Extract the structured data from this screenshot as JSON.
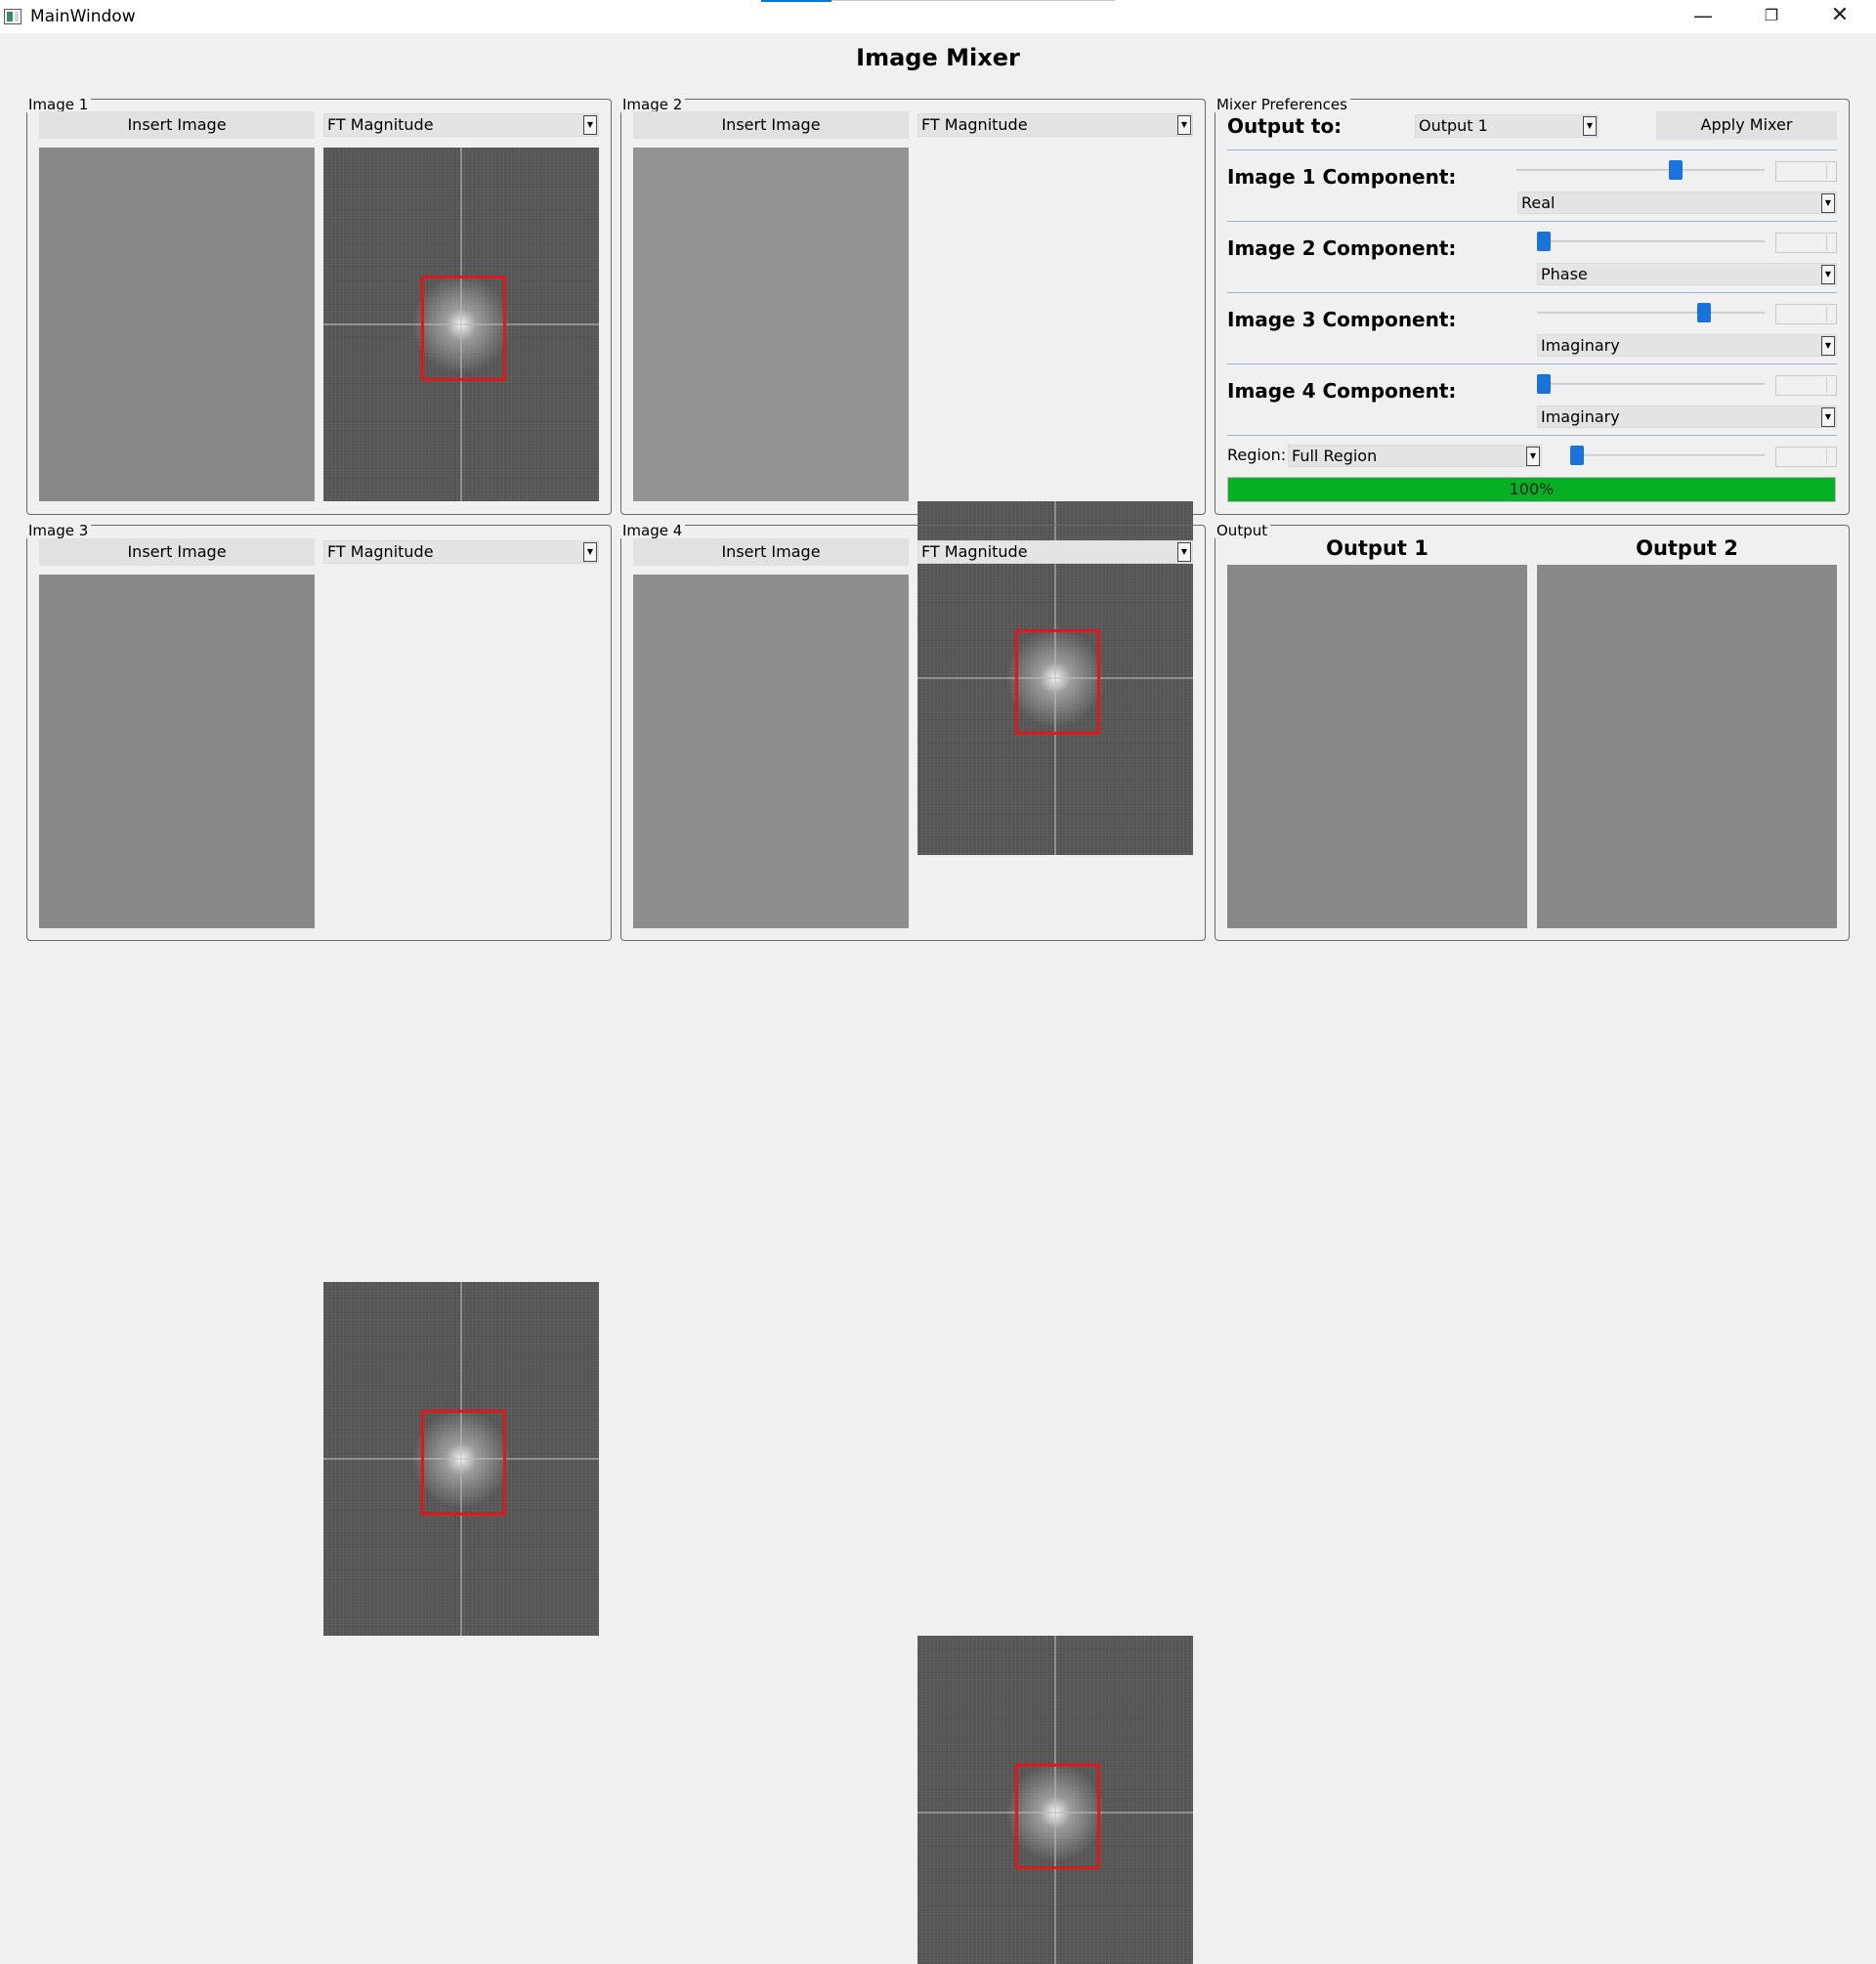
{
  "window": {
    "title": "MainWindow",
    "minimize": "—",
    "maximize": "❐",
    "close": "✕"
  },
  "app": {
    "title": "Image Mixer"
  },
  "panels": [
    {
      "title": "Image 1",
      "insert_label": "Insert Image",
      "ft_select": "FT Magnitude"
    },
    {
      "title": "Image 2",
      "insert_label": "Insert Image",
      "ft_select": "FT Magnitude"
    },
    {
      "title": "Image 3",
      "insert_label": "Insert Image",
      "ft_select": "FT Magnitude"
    },
    {
      "title": "Image 4",
      "insert_label": "Insert Image",
      "ft_select": "FT Magnitude"
    }
  ],
  "mixer": {
    "title": "Mixer Preferences",
    "output_label": "Output to:",
    "output_select": "Output 1",
    "apply_label": "Apply Mixer",
    "components": [
      {
        "label": "Image 1 Component:",
        "type": "Real",
        "weight_fraction": 0.65
      },
      {
        "label": "Image 2 Component:",
        "type": "Phase",
        "weight_fraction": 0.0
      },
      {
        "label": "Image 3 Component:",
        "type": "Imaginary",
        "weight_fraction": 0.75
      },
      {
        "label": "Image 4 Component:",
        "type": "Imaginary",
        "weight_fraction": 0.0
      }
    ],
    "region_label": "Region:",
    "region_select": "Full Region",
    "region_fraction": 0.0,
    "progress_percent": 100,
    "progress_text": "100%",
    "progress_color": "#06b025",
    "slider_color": "#1a73d9"
  },
  "output": {
    "title": "Output",
    "output1_label": "Output 1",
    "output2_label": "Output 2"
  },
  "colors": {
    "region_rect": "#e01818",
    "background": "#f0f0f0"
  }
}
